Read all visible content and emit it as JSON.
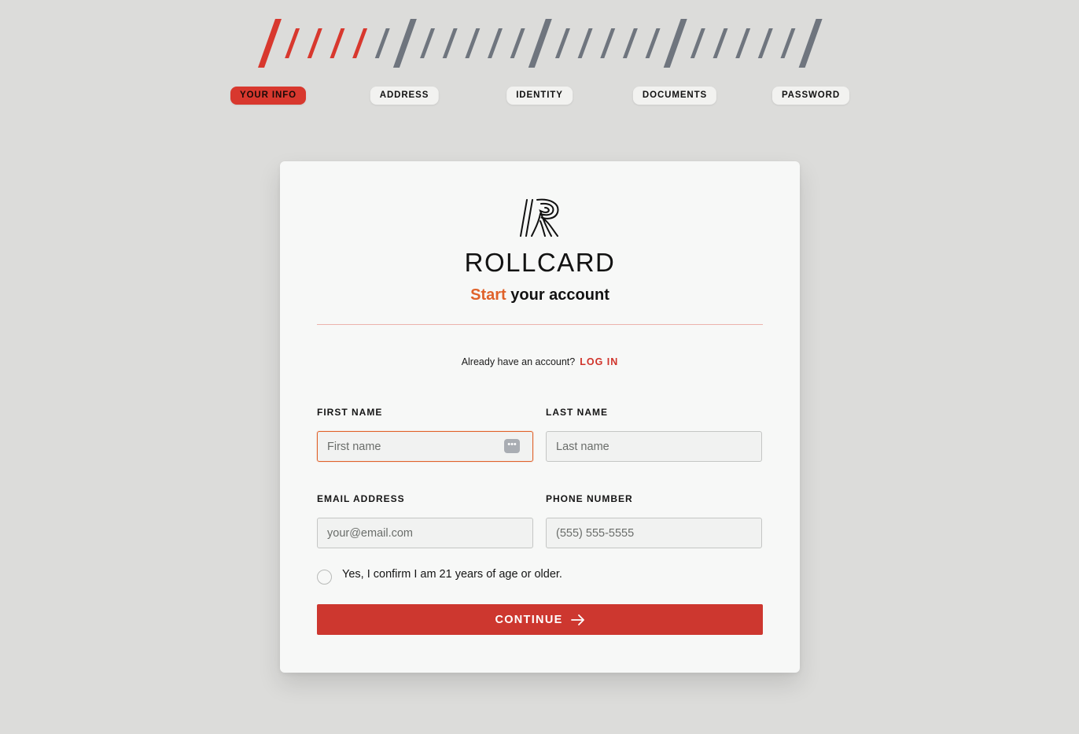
{
  "steps": [
    {
      "label": "YOUR INFO",
      "active": true
    },
    {
      "label": "ADDRESS",
      "active": false
    },
    {
      "label": "IDENTITY",
      "active": false
    },
    {
      "label": "DOCUMENTS",
      "active": false
    },
    {
      "label": "PASSWORD",
      "active": false
    }
  ],
  "progress": {
    "completed_ticks": 5,
    "total_ticks": 25,
    "major_every": 6,
    "active_color": "#d8382e",
    "inactive_color": "#6f757e"
  },
  "brand": {
    "name": "ROLLCARD",
    "subtitle_accent": "Start",
    "subtitle_rest": " your account"
  },
  "login": {
    "prompt": "Already have an account?",
    "link": "LOG IN"
  },
  "form": {
    "first_name": {
      "label": "FIRST NAME",
      "placeholder": "First name",
      "value": ""
    },
    "last_name": {
      "label": "LAST NAME",
      "placeholder": "Last name",
      "value": ""
    },
    "email": {
      "label": "EMAIL ADDRESS",
      "placeholder": "your@email.com",
      "value": ""
    },
    "phone": {
      "label": "PHONE NUMBER",
      "placeholder": "(555) 555-5555",
      "value": ""
    },
    "age_confirm": {
      "label": "Yes, I confirm I am 21 years of age or older.",
      "checked": false
    }
  },
  "continue_button": {
    "label": "CONTINUE"
  },
  "icons": {
    "autofill": "autofill-key-icon",
    "arrow": "arrow-right-icon",
    "logo": "rollcard-logo-icon"
  },
  "colors": {
    "accent_red": "#cd372f",
    "accent_orange": "#e0622a",
    "background": "#dcdcda",
    "card": "#f7f8f7"
  }
}
